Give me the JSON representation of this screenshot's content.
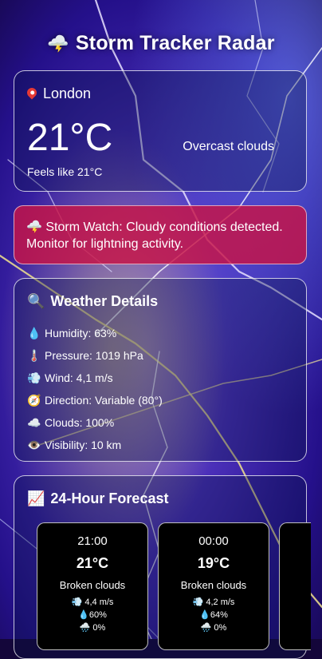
{
  "app": {
    "title": "Storm Tracker Radar",
    "title_icon": "lightning-cloud-icon"
  },
  "current": {
    "location": "London",
    "temperature": "21°C",
    "description": "Overcast clouds",
    "feels_like": "Feels like 21°C"
  },
  "alert": {
    "icon": "lightning-cloud-icon",
    "text": "Storm Watch: Cloudy conditions detected. Monitor for lightning activity."
  },
  "details": {
    "title": "Weather Details",
    "items": [
      {
        "icon": "droplet-icon",
        "text": "Humidity: 63%"
      },
      {
        "icon": "thermometer-icon",
        "text": "Pressure: 1019 hPa"
      },
      {
        "icon": "wind-icon",
        "text": "Wind: 4,1 m/s"
      },
      {
        "icon": "compass-icon",
        "text": "Direction: Variable (80°)"
      },
      {
        "icon": "cloud-icon",
        "text": "Clouds: 100%"
      },
      {
        "icon": "eye-icon",
        "text": "Visibility: 10 km"
      }
    ]
  },
  "forecast": {
    "title": "24-Hour Forecast",
    "items": [
      {
        "time": "21:00",
        "temp": "21°C",
        "desc": "Broken clouds",
        "wind": "4,4 m/s",
        "humidity": "60%",
        "rain": "0%"
      },
      {
        "time": "00:00",
        "temp": "19°C",
        "desc": "Broken clouds",
        "wind": "4,2 m/s",
        "humidity": "64%",
        "rain": "0%"
      }
    ]
  },
  "colors": {
    "accent_alert": "#c81446",
    "background": "#14063a"
  }
}
